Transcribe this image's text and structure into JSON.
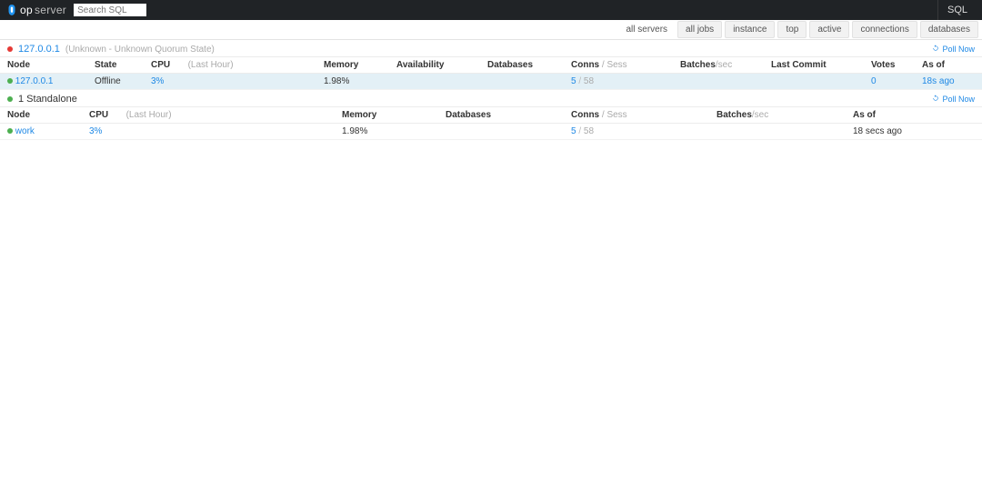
{
  "brand": {
    "op": "op",
    "server": "server"
  },
  "search": {
    "placeholder": "Search SQL"
  },
  "topright_tab": "SQL",
  "tabs": {
    "plain": "all servers",
    "items": [
      "all jobs",
      "instance",
      "top",
      "active",
      "connections",
      "databases"
    ]
  },
  "poll_label": "Poll Now",
  "groups": [
    {
      "dot": "red",
      "title_link": "127.0.0.1",
      "title_note": "(Unknown - Unknown Quorum State)",
      "columns": [
        {
          "label": "Node"
        },
        {
          "label": "State"
        },
        {
          "label": "CPU",
          "note": "(Last Hour)"
        },
        {
          "label": "Memory"
        },
        {
          "label": "Availability"
        },
        {
          "label": "Databases"
        },
        {
          "label": "Conns",
          "note": "/ Sess"
        },
        {
          "label": "Batches",
          "note": "/sec"
        },
        {
          "label": "Last Commit"
        },
        {
          "label": "Votes"
        },
        {
          "label": "As of"
        }
      ],
      "rows": [
        {
          "hl": true,
          "dot": "green",
          "node": "127.0.0.1",
          "state": "Offline",
          "cpu": "3%",
          "memory": "1.98%",
          "availability": "",
          "databases": "",
          "conns_a": "5",
          "conns_b": "58",
          "batches": "",
          "last_commit": "",
          "votes": "0",
          "asof": "18s ago"
        }
      ]
    },
    {
      "dot": "green",
      "title_text": "1 Standalone",
      "columns": [
        {
          "label": "Node"
        },
        {
          "label": "CPU",
          "note": "(Last Hour)"
        },
        {
          "label": "Memory"
        },
        {
          "label": "Databases"
        },
        {
          "label": "Conns",
          "note": "/ Sess"
        },
        {
          "label": "Batches",
          "note": "/sec"
        },
        {
          "label": "As of"
        }
      ],
      "rows": [
        {
          "hl": false,
          "dot": "green",
          "node": "work",
          "cpu": "3%",
          "memory": "1.98%",
          "databases": "",
          "conns_a": "5",
          "conns_b": "58",
          "batches": "",
          "asof": "18 secs ago"
        }
      ]
    }
  ]
}
